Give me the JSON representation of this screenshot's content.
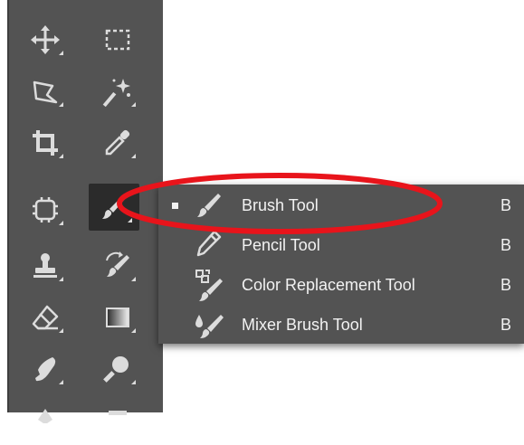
{
  "toolbar": {
    "tools": [
      {
        "name": "move-tool",
        "icon": "move-icon"
      },
      {
        "name": "rectangular-marquee-tool",
        "icon": "marquee-icon"
      },
      {
        "name": "polygonal-lasso-tool",
        "icon": "lasso-icon"
      },
      {
        "name": "magic-wand-tool",
        "icon": "magic-wand-icon"
      },
      {
        "name": "crop-tool",
        "icon": "crop-icon"
      },
      {
        "name": "eyedropper-tool",
        "icon": "eyedropper-icon"
      },
      {
        "name": "spot-healing-tool",
        "icon": "healing-icon"
      },
      {
        "name": "brush-tool",
        "icon": "brush-icon",
        "selected": true
      },
      {
        "name": "clone-stamp-tool",
        "icon": "stamp-icon"
      },
      {
        "name": "history-brush-tool",
        "icon": "history-brush-icon"
      },
      {
        "name": "eraser-tool",
        "icon": "eraser-icon"
      },
      {
        "name": "gradient-tool",
        "icon": "gradient-icon"
      },
      {
        "name": "smudge-tool",
        "icon": "smudge-icon"
      },
      {
        "name": "dodge-tool",
        "icon": "dodge-icon"
      }
    ]
  },
  "flyout": {
    "items": [
      {
        "label": "Brush Tool",
        "shortcut": "B",
        "icon": "brush-icon",
        "checked": true
      },
      {
        "label": "Pencil Tool",
        "shortcut": "B",
        "icon": "pencil-icon",
        "checked": false
      },
      {
        "label": "Color Replacement Tool",
        "shortcut": "B",
        "icon": "color-replacement-icon",
        "checked": false
      },
      {
        "label": "Mixer Brush Tool",
        "shortcut": "B",
        "icon": "mixer-brush-icon",
        "checked": false
      }
    ]
  },
  "colors": {
    "panel": "#535353",
    "selected_tool": "#2b2b2b",
    "icon": "#dcdcdc",
    "text": "#f2f2f2",
    "annotation": "#e8141b"
  }
}
